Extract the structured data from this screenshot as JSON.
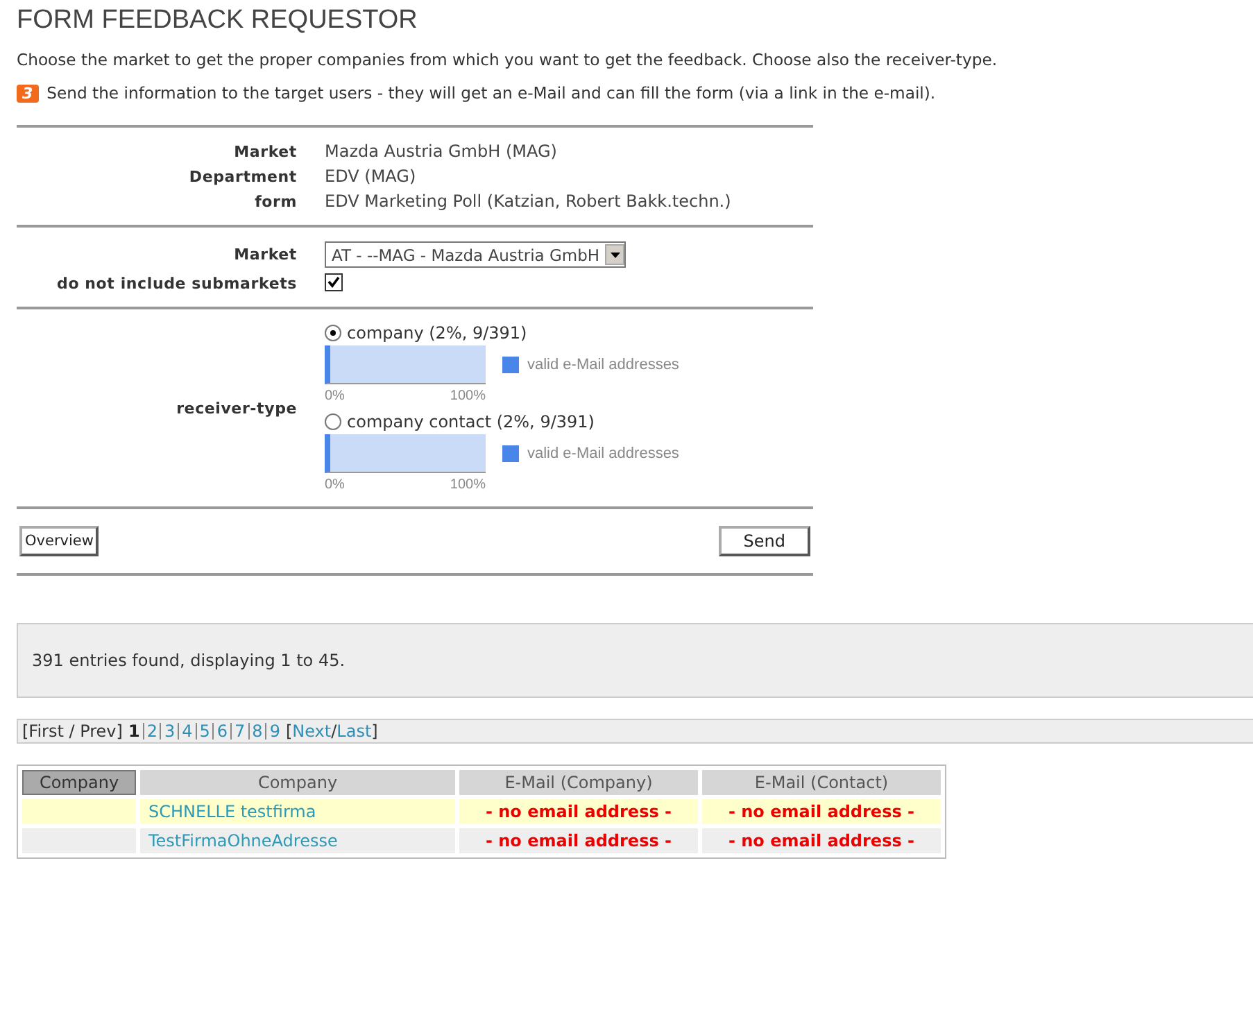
{
  "title": "FORM FEEDBACK REQUESTOR",
  "intro": "Choose the market to get the proper companies from which you want to get the feedback. Choose also the receiver-type.",
  "step": {
    "badge": "3",
    "text": "Send the information to the target users - they will get an e-Mail and can fill the form (via a link in the e-mail)."
  },
  "info": [
    {
      "label": "Market",
      "value": "Mazda Austria GmbH (MAG)"
    },
    {
      "label": "Department",
      "value": "EDV (MAG)"
    },
    {
      "label": "form",
      "value": "EDV Marketing Poll (Katzian, Robert Bakk.techn.)"
    }
  ],
  "market": {
    "label": "Market",
    "value": "AT - --MAG - Mazda Austria GmbH"
  },
  "submarkets": {
    "label": "do not include submarkets",
    "checked": true
  },
  "receiver_type": {
    "label": "receiver-type",
    "options": [
      {
        "label": "company (2%, 9/391)",
        "selected": true,
        "level": 0.02,
        "legend": "valid e-Mail addresses",
        "min": "0%",
        "max": "100%"
      },
      {
        "label": "company contact (2%, 9/391)",
        "selected": false,
        "level": 0.02,
        "legend": "valid e-Mail addresses",
        "min": "0%",
        "max": "100%"
      }
    ]
  },
  "buttons": {
    "overview": "Overview",
    "send": "Send"
  },
  "summary": "391 entries found, displaying 1 to 45.",
  "pager": {
    "first_prev": "[First / Prev]",
    "pages": [
      {
        "label": "1",
        "selected": true
      },
      {
        "label": "2",
        "selected": false
      },
      {
        "label": "3",
        "selected": false
      },
      {
        "label": "4",
        "selected": false
      },
      {
        "label": "5",
        "selected": false
      },
      {
        "label": "6",
        "selected": false
      },
      {
        "label": "7",
        "selected": false
      },
      {
        "label": "8",
        "selected": false
      },
      {
        "label": "9",
        "selected": false
      }
    ],
    "open": "[",
    "next": "Next",
    "slash": "/",
    "last": "Last",
    "close": "]"
  },
  "table": {
    "columns": [
      "Company",
      "Company",
      "E-Mail (Company)",
      "E-Mail (Contact)"
    ],
    "rows": [
      {
        "company": "SCHNELLE testfirma",
        "email_company": "- no email address -",
        "email_contact": "- no email address -"
      },
      {
        "company": "TestFirmaOhneAdresse",
        "email_company": "- no email address -",
        "email_contact": "- no email address -"
      }
    ]
  }
}
